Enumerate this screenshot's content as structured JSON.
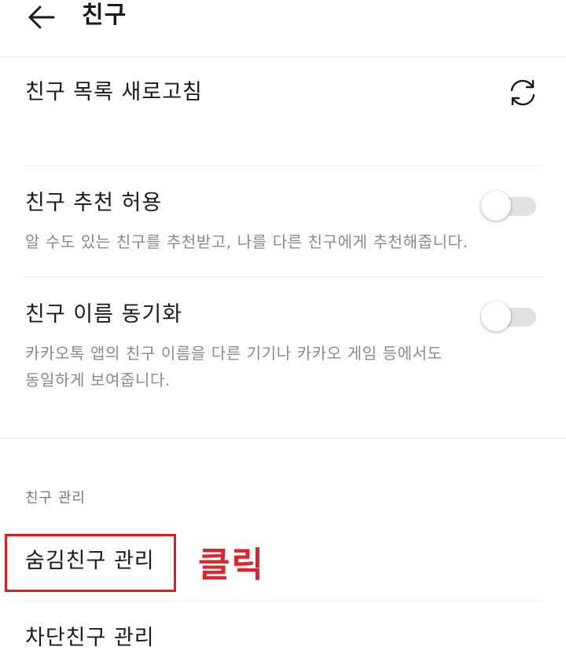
{
  "header": {
    "title": "친구",
    "back_icon": "arrow-left-icon"
  },
  "settings": {
    "refresh": {
      "label": "친구 목록 새로고침",
      "icon": "refresh-icon"
    },
    "recommend": {
      "label": "친구 추천 허용",
      "description": "알 수도 있는 친구를 추천받고, 나를 다른 친구에게 추천해줍니다.",
      "enabled": false
    },
    "name_sync": {
      "label": "친구 이름 동기화",
      "description_line1": "카카오톡 앱의 친구 이름을 다른 기기나 카카오 게임 등에서도",
      "description_line2": "동일하게 보여줍니다.",
      "enabled": false
    }
  },
  "management": {
    "section_label": "친구 관리",
    "items": [
      {
        "label": "숨김친구 관리"
      },
      {
        "label": "차단친구 관리"
      }
    ]
  },
  "annotation": {
    "text": "클릭",
    "color": "#e0232a"
  }
}
